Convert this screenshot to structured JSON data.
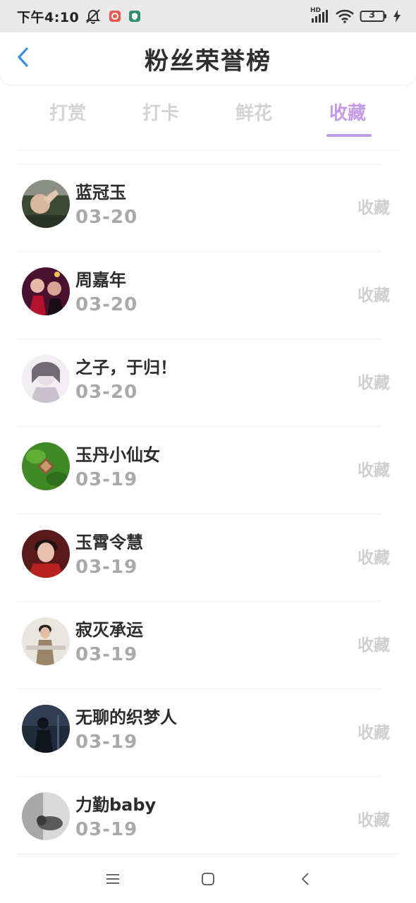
{
  "status_bar": {
    "time": "下午4:10",
    "battery": "3",
    "network_label": "HD"
  },
  "header": {
    "title": "粉丝荣誉榜"
  },
  "tabs": [
    {
      "label": "打赏",
      "active": false
    },
    {
      "label": "打卡",
      "active": false
    },
    {
      "label": "鲜花",
      "active": false
    },
    {
      "label": "收藏",
      "active": true
    }
  ],
  "colors": {
    "accent": "#c49ae6",
    "back_arrow": "#3a8ee6",
    "inactive_tab": "#d3d3d3",
    "date_text": "#a9a9a9",
    "action_text": "#cfcfcf"
  },
  "fans": [
    {
      "name": "蓝冠玉",
      "date": "03-20",
      "action": "收藏",
      "avatar_icon": "avatar-photo-hand"
    },
    {
      "name": "周嘉年",
      "date": "03-20",
      "action": "收藏",
      "avatar_icon": "avatar-photo-girls"
    },
    {
      "name": "之子，于归！",
      "date": "03-20",
      "action": "收藏",
      "avatar_icon": "avatar-photo-sketch"
    },
    {
      "name": "玉丹小仙女",
      "date": "03-19",
      "action": "收藏",
      "avatar_icon": "avatar-photo-butterfly"
    },
    {
      "name": "玉霄令慧",
      "date": "03-19",
      "action": "收藏",
      "avatar_icon": "avatar-photo-man-red"
    },
    {
      "name": "寂灭承运",
      "date": "03-19",
      "action": "收藏",
      "avatar_icon": "avatar-photo-man-coat"
    },
    {
      "name": "无聊的织梦人",
      "date": "03-19",
      "action": "收藏",
      "avatar_icon": "avatar-photo-night"
    },
    {
      "name": "力勤baby",
      "date": "03-19",
      "action": "收藏",
      "avatar_icon": "avatar-photo-bw"
    }
  ],
  "nav_bar": {
    "menu_icon": "menu-icon",
    "home_icon": "home-square-icon",
    "back_icon": "back-triangle-icon"
  }
}
